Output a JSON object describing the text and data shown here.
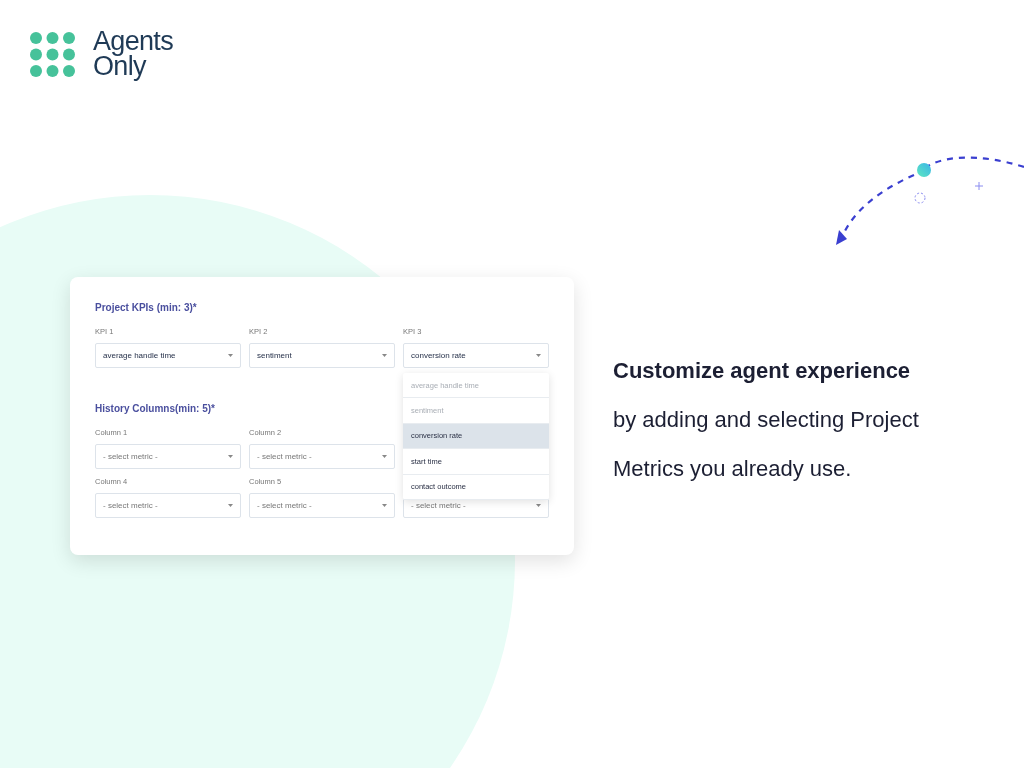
{
  "logo": {
    "lines": [
      "Agents",
      "Only"
    ]
  },
  "card": {
    "sections": [
      {
        "title": "Project KPIs (min: 3)*",
        "fields": [
          {
            "kind": "select",
            "label": "KPI 1",
            "value": "average handle time"
          },
          {
            "kind": "select",
            "label": "KPI 2",
            "value": "sentiment"
          },
          {
            "kind": "select",
            "label": "KPI 3",
            "value": "conversion rate",
            "options": [
              {
                "label": "average handle time",
                "disabled": true,
                "selected": false
              },
              {
                "label": "sentiment",
                "disabled": true,
                "selected": false
              },
              {
                "label": "conversion rate",
                "disabled": false,
                "selected": true
              },
              {
                "label": "start time",
                "disabled": false,
                "selected": false
              },
              {
                "label": "contact outcome",
                "disabled": false,
                "selected": false
              }
            ]
          }
        ]
      },
      {
        "title": "History Columns(min: 5)*",
        "fields": [
          {
            "kind": "select",
            "label": "Column 1",
            "placeholder": "- select metric -"
          },
          {
            "kind": "select",
            "label": "Column 2",
            "placeholder": "- select metric -"
          },
          {
            "kind": "covered"
          },
          {
            "kind": "select",
            "label": "Column 4",
            "placeholder": "- select metric -"
          },
          {
            "kind": "select",
            "label": "Column 5",
            "placeholder": "- select metric -"
          },
          {
            "kind": "select",
            "placeholder": "- select metric -"
          }
        ]
      }
    ]
  },
  "tagline": {
    "heading": "Customize agent experience",
    "lines": [
      "by adding and selecting Project",
      "Metrics you already use."
    ]
  }
}
